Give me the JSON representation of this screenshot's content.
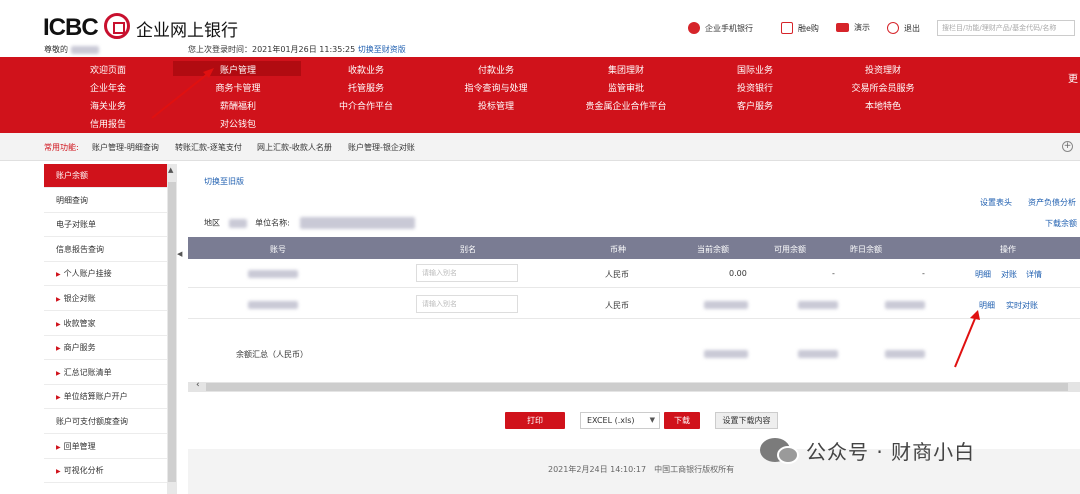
{
  "header": {
    "logo_text": "ICBC",
    "brand_name": "企业网上银行",
    "welcome_prefix": "尊敬的",
    "last_login": "您上次登录时间：2021年01月26日 11:35:25",
    "switch_finance": "切换至财资版",
    "tools": [
      {
        "label": "企业手机银行",
        "icon": "mobile-bank-icon"
      },
      {
        "label": "融e购",
        "icon": "cart-icon"
      },
      {
        "label": "演示",
        "icon": "demo-icon"
      },
      {
        "label": "退出",
        "icon": "power-icon"
      }
    ],
    "search_placeholder": "搜栏目/功能/理财产品/基金代码/名称"
  },
  "nav": {
    "rows": [
      [
        "欢迎页面",
        "账户管理",
        "收款业务",
        "付款业务",
        "集团理财",
        "国际业务",
        "投资理财"
      ],
      [
        "企业年金",
        "商务卡管理",
        "托管服务",
        "指令查询与处理",
        "监管审批",
        "投资银行",
        "交易所会员服务"
      ],
      [
        "海关业务",
        "薪酬福利",
        "中介合作平台",
        "投标管理",
        "贵金属企业合作平台",
        "客户服务",
        "本地特色"
      ],
      [
        "信用报告",
        "对公钱包"
      ]
    ],
    "active": "账户管理",
    "right_edge_text": "更"
  },
  "quickbar": {
    "label": "常用功能:",
    "links": [
      "账户管理-明细查询",
      "转账汇款-逐笔支付",
      "网上汇款-收款人名册",
      "账户管理-银企对账"
    ]
  },
  "sidebar": {
    "items": [
      {
        "label": "账户余额",
        "active": true,
        "arrow": false
      },
      {
        "label": "明细查询",
        "active": false,
        "arrow": false
      },
      {
        "label": "电子对账单",
        "active": false,
        "arrow": false
      },
      {
        "label": "信息报告查询",
        "active": false,
        "arrow": false
      },
      {
        "label": "个人账户挂接",
        "active": false,
        "arrow": true
      },
      {
        "label": "银企对账",
        "active": false,
        "arrow": true
      },
      {
        "label": "收款管家",
        "active": false,
        "arrow": true
      },
      {
        "label": "商户服务",
        "active": false,
        "arrow": true
      },
      {
        "label": "汇总记账清单",
        "active": false,
        "arrow": true
      },
      {
        "label": "单位结算账户开户",
        "active": false,
        "arrow": true
      },
      {
        "label": "账户可支付额度查询",
        "active": false,
        "arrow": false
      },
      {
        "label": "回单管理",
        "active": false,
        "arrow": true
      },
      {
        "label": "可视化分析",
        "active": false,
        "arrow": true
      }
    ]
  },
  "main": {
    "switch_old": "切换至旧版",
    "top_links": [
      "设置表头",
      "资产负债分析"
    ],
    "download_balance": "下载余额",
    "region_label": "地区",
    "unit_label": "单位名称:",
    "table": {
      "headers": [
        "账号",
        "别名",
        "币种",
        "当前余额",
        "可用余额",
        "昨日余额",
        "操作"
      ],
      "rows": [
        {
          "alias_placeholder": "请输入别名",
          "currency": "人民币",
          "current": "0.00",
          "available": "-",
          "yesterday": "-",
          "ops": [
            "明细",
            "对账",
            "详情"
          ]
        },
        {
          "alias_placeholder": "请输入别名",
          "currency": "人民币",
          "current": "",
          "available": "",
          "yesterday": "",
          "ops": [
            "明细",
            "实时对账"
          ]
        }
      ],
      "summary_label": "余额汇总（人民币）"
    },
    "print_label": "打印",
    "format_value": "EXCEL (.xls)",
    "download_label": "下载",
    "settings_label": "设置下载内容",
    "footer": "2021年2月24日 14:10:17　中国工商银行版权所有"
  },
  "watermark": "公众号 · 财商小白",
  "colors": {
    "brand_red": "#d0121b",
    "table_head": "#7a7c93",
    "link_blue": "#1f5fb0"
  }
}
